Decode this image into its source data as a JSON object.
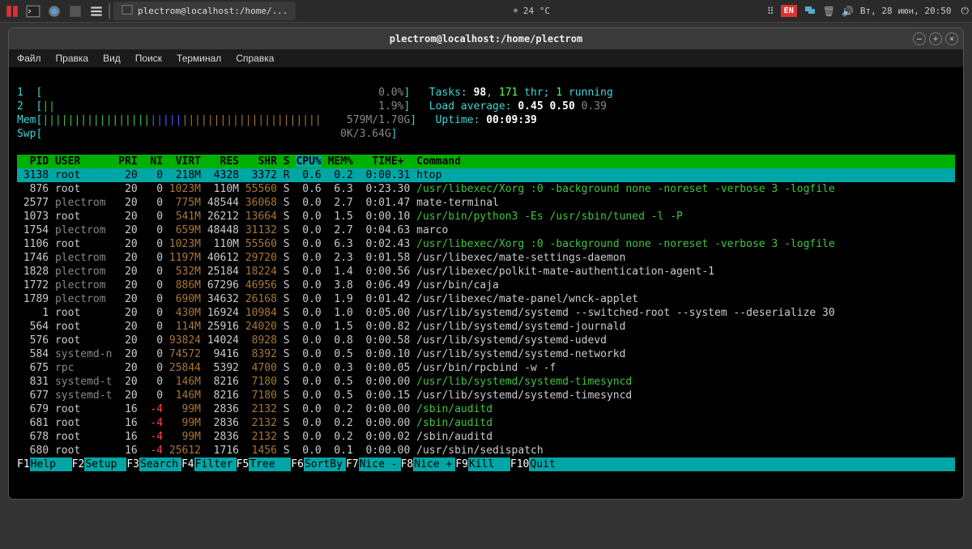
{
  "taskbar": {
    "task_label": "plectrom@localhost:/home/...",
    "weather": "24 °C",
    "lang": "EN",
    "clock": "Вт, 28 июн, 20:50"
  },
  "window": {
    "title": "plectrom@localhost:/home/plectrom"
  },
  "menu": {
    "file": "Файл",
    "edit": "Правка",
    "view": "Вид",
    "search": "Поиск",
    "terminal": "Терминал",
    "help": "Справка"
  },
  "htop": {
    "cpu1_label": "1",
    "cpu1_pct": "0.0%",
    "cpu2_label": "2",
    "cpu2_pct": "1.9%",
    "mem_label": "Mem",
    "mem_val": "579M/1.70G",
    "swp_label": "Swp",
    "swp_val": "0K/3.64G",
    "tasks_label": "Tasks: ",
    "tasks_count": "98",
    "tasks_sep": ", ",
    "tasks_thr": "171",
    "tasks_thr_label": " thr; ",
    "tasks_running": "1",
    "tasks_running_label": " running",
    "load_label": "Load average: ",
    "load1": "0.45",
    "load2": "0.50",
    "load3": "0.39",
    "uptime_label": "Uptime: ",
    "uptime_val": "00:09:39",
    "header": {
      "pid": "PID",
      "user": "USER",
      "pri": "PRI",
      "ni": "NI",
      "virt": "VIRT",
      "res": "RES",
      "shr": "SHR",
      "s": "S",
      "cpu": "CPU%",
      "mem": "MEM%",
      "time": "TIME+",
      "cmd": "Command"
    },
    "processes": [
      {
        "pid": "3138",
        "user": "root",
        "pri": "20",
        "ni": "0",
        "virt": "218M",
        "res": "4328",
        "shr": "3372",
        "s": "R",
        "cpu": "0.6",
        "mem": "0.2",
        "time": "0:00.31",
        "cmd": "htop",
        "selected": true
      },
      {
        "pid": "876",
        "user": "root",
        "pri": "20",
        "ni": "0",
        "virt": "1023M",
        "res": "110M",
        "shr": "55560",
        "s": "S",
        "cpu": "0.6",
        "mem": "6.3",
        "time": "0:23.30",
        "cmd": "/usr/libexec/Xorg :0 -background none -noreset -verbose 3 -logfile",
        "cmdcolor": "green"
      },
      {
        "pid": "2577",
        "user": "plectrom",
        "pri": "20",
        "ni": "0",
        "virt": "775M",
        "res": "48544",
        "shr": "36068",
        "s": "S",
        "cpu": "0.0",
        "mem": "2.7",
        "time": "0:01.47",
        "cmd": "mate-terminal"
      },
      {
        "pid": "1073",
        "user": "root",
        "pri": "20",
        "ni": "0",
        "virt": "541M",
        "res": "26212",
        "shr": "13664",
        "s": "S",
        "cpu": "0.0",
        "mem": "1.5",
        "time": "0:00.10",
        "cmd": "/usr/bin/python3 -Es /usr/sbin/tuned -l -P",
        "cmdcolor": "green"
      },
      {
        "pid": "1754",
        "user": "plectrom",
        "pri": "20",
        "ni": "0",
        "virt": "659M",
        "res": "48448",
        "shr": "31132",
        "s": "S",
        "cpu": "0.0",
        "mem": "2.7",
        "time": "0:04.63",
        "cmd": "marco"
      },
      {
        "pid": "1106",
        "user": "root",
        "pri": "20",
        "ni": "0",
        "virt": "1023M",
        "res": "110M",
        "shr": "55560",
        "s": "S",
        "cpu": "0.0",
        "mem": "6.3",
        "time": "0:02.43",
        "cmd": "/usr/libexec/Xorg :0 -background none -noreset -verbose 3 -logfile",
        "cmdcolor": "green"
      },
      {
        "pid": "1746",
        "user": "plectrom",
        "pri": "20",
        "ni": "0",
        "virt": "1197M",
        "res": "40612",
        "shr": "29720",
        "s": "S",
        "cpu": "0.0",
        "mem": "2.3",
        "time": "0:01.58",
        "cmd": "/usr/libexec/mate-settings-daemon"
      },
      {
        "pid": "1828",
        "user": "plectrom",
        "pri": "20",
        "ni": "0",
        "virt": "532M",
        "res": "25184",
        "shr": "18224",
        "s": "S",
        "cpu": "0.0",
        "mem": "1.4",
        "time": "0:00.56",
        "cmd": "/usr/libexec/polkit-mate-authentication-agent-1"
      },
      {
        "pid": "1772",
        "user": "plectrom",
        "pri": "20",
        "ni": "0",
        "virt": "886M",
        "res": "67296",
        "shr": "46956",
        "s": "S",
        "cpu": "0.0",
        "mem": "3.8",
        "time": "0:06.49",
        "cmd": "/usr/bin/caja"
      },
      {
        "pid": "1789",
        "user": "plectrom",
        "pri": "20",
        "ni": "0",
        "virt": "690M",
        "res": "34632",
        "shr": "26168",
        "s": "S",
        "cpu": "0.0",
        "mem": "1.9",
        "time": "0:01.42",
        "cmd": "/usr/libexec/mate-panel/wnck-applet"
      },
      {
        "pid": "1",
        "user": "root",
        "pri": "20",
        "ni": "0",
        "virt": "430M",
        "res": "16924",
        "shr": "10984",
        "s": "S",
        "cpu": "0.0",
        "mem": "1.0",
        "time": "0:05.00",
        "cmd": "/usr/lib/systemd/systemd --switched-root --system --deserialize 30"
      },
      {
        "pid": "564",
        "user": "root",
        "pri": "20",
        "ni": "0",
        "virt": "114M",
        "res": "25916",
        "shr": "24020",
        "s": "S",
        "cpu": "0.0",
        "mem": "1.5",
        "time": "0:00.82",
        "cmd": "/usr/lib/systemd/systemd-journald"
      },
      {
        "pid": "576",
        "user": "root",
        "pri": "20",
        "ni": "0",
        "virt": "93824",
        "res": "14024",
        "shr": "8928",
        "s": "S",
        "cpu": "0.0",
        "mem": "0.8",
        "time": "0:00.58",
        "cmd": "/usr/lib/systemd/systemd-udevd"
      },
      {
        "pid": "584",
        "user": "systemd-n",
        "pri": "20",
        "ni": "0",
        "virt": "74572",
        "res": "9416",
        "shr": "8392",
        "s": "S",
        "cpu": "0.0",
        "mem": "0.5",
        "time": "0:00.10",
        "cmd": "/usr/lib/systemd/systemd-networkd"
      },
      {
        "pid": "675",
        "user": "rpc",
        "pri": "20",
        "ni": "0",
        "virt": "25844",
        "res": "5392",
        "shr": "4700",
        "s": "S",
        "cpu": "0.0",
        "mem": "0.3",
        "time": "0:00.05",
        "cmd": "/usr/bin/rpcbind -w -f"
      },
      {
        "pid": "831",
        "user": "systemd-t",
        "pri": "20",
        "ni": "0",
        "virt": "146M",
        "res": "8216",
        "shr": "7180",
        "s": "S",
        "cpu": "0.0",
        "mem": "0.5",
        "time": "0:00.00",
        "cmd": "/usr/lib/systemd/systemd-timesyncd",
        "cmdcolor": "green"
      },
      {
        "pid": "677",
        "user": "systemd-t",
        "pri": "20",
        "ni": "0",
        "virt": "146M",
        "res": "8216",
        "shr": "7180",
        "s": "S",
        "cpu": "0.0",
        "mem": "0.5",
        "time": "0:00.15",
        "cmd": "/usr/lib/systemd/systemd-timesyncd"
      },
      {
        "pid": "679",
        "user": "root",
        "pri": "16",
        "ni": "-4",
        "virt": "99M",
        "res": "2836",
        "shr": "2132",
        "s": "S",
        "cpu": "0.0",
        "mem": "0.2",
        "time": "0:00.00",
        "cmd": "/sbin/auditd",
        "cmdcolor": "green",
        "nired": true
      },
      {
        "pid": "681",
        "user": "root",
        "pri": "16",
        "ni": "-4",
        "virt": "99M",
        "res": "2836",
        "shr": "2132",
        "s": "S",
        "cpu": "0.0",
        "mem": "0.2",
        "time": "0:00.00",
        "cmd": "/sbin/auditd",
        "cmdcolor": "green",
        "nired": true
      },
      {
        "pid": "678",
        "user": "root",
        "pri": "16",
        "ni": "-4",
        "virt": "99M",
        "res": "2836",
        "shr": "2132",
        "s": "S",
        "cpu": "0.0",
        "mem": "0.2",
        "time": "0:00.02",
        "cmd": "/sbin/auditd",
        "nired": true
      },
      {
        "pid": "680",
        "user": "root",
        "pri": "16",
        "ni": "-4",
        "virt": "25612",
        "res": "1716",
        "shr": "1456",
        "s": "S",
        "cpu": "0.0",
        "mem": "0.1",
        "time": "0:00.00",
        "cmd": "/usr/sbin/sedispatch",
        "nired": true
      }
    ],
    "footer": [
      {
        "key": "F1",
        "label": "Help  "
      },
      {
        "key": "F2",
        "label": "Setup "
      },
      {
        "key": "F3",
        "label": "Search"
      },
      {
        "key": "F4",
        "label": "Filter"
      },
      {
        "key": "F5",
        "label": "Tree  "
      },
      {
        "key": "F6",
        "label": "SortBy"
      },
      {
        "key": "F7",
        "label": "Nice -"
      },
      {
        "key": "F8",
        "label": "Nice +"
      },
      {
        "key": "F9",
        "label": "Kill  "
      },
      {
        "key": "F10",
        "label": "Quit"
      }
    ]
  }
}
